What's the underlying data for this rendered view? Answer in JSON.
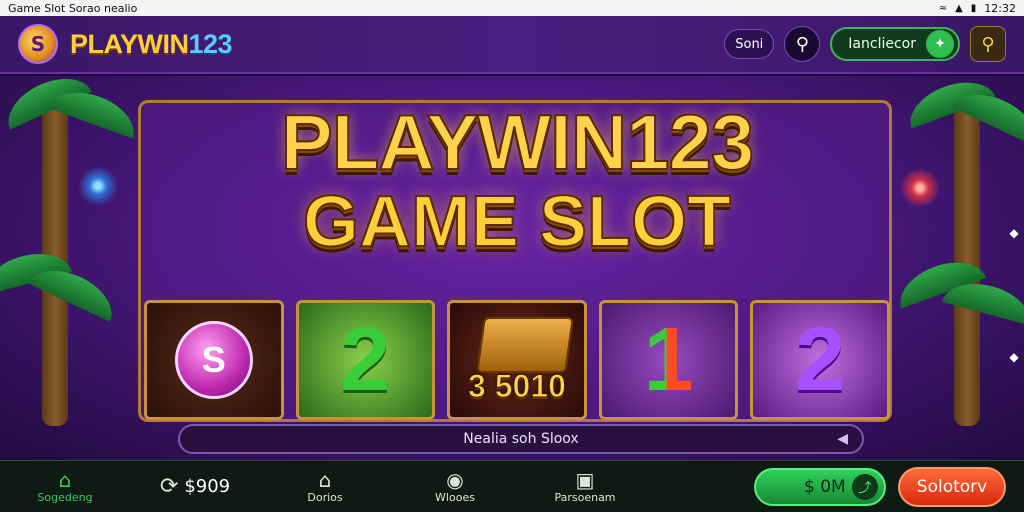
{
  "status_bar": {
    "title": "Game Slot  Sorao nealio",
    "time": "12:32"
  },
  "header": {
    "logo_badge": "S",
    "logo_word": "PLAYWIN",
    "logo_number": "123",
    "pill_label": "Soni",
    "search_icon": "search-icon",
    "language_label": "Iancliecor",
    "language_icon": "gem-icon",
    "key_icon": "key-icon"
  },
  "hero": {
    "headline_1": "PLAYWIN123",
    "headline_2": "GAME SLOT"
  },
  "reels": {
    "symbols": [
      {
        "text": "S",
        "kind": "coin"
      },
      {
        "text": "2",
        "kind": "green"
      },
      {
        "text": "3 5010",
        "kind": "chest"
      },
      {
        "text": "1",
        "kind": "mix"
      },
      {
        "text": "2",
        "kind": "purple"
      }
    ]
  },
  "search": {
    "text": "Nealia soh Sloox"
  },
  "bottom_nav": {
    "home_label": "Sogedeng",
    "balance": "$909",
    "item2_label": "Dorios",
    "item3_label": "Wlooes",
    "item4_label": "Parsoenam",
    "bet_label": "$ 0M",
    "cta_label": "Solotorv"
  },
  "colors": {
    "accent_gold": "#ffcf3a",
    "accent_green": "#2fd05a",
    "accent_orange": "#ff6a3a",
    "background_purple": "#4a1880"
  }
}
